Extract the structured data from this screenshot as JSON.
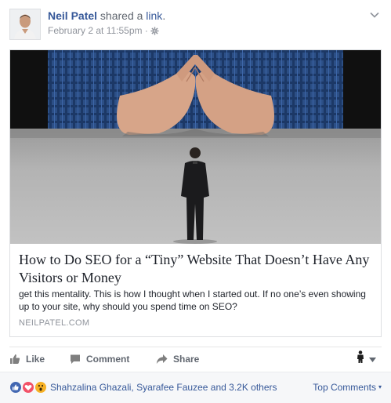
{
  "header": {
    "author": "Neil Patel",
    "action_text": " shared a ",
    "link_word": "link",
    "period": ".",
    "timestamp": "February 2 at 11:55pm",
    "separator": " · ",
    "audience_icon": "gear-icon",
    "menu_icon": "chevron-down-icon"
  },
  "card": {
    "title": "How to Do SEO for a “Tiny” Website That Doesn’t Have Any Visitors or Money",
    "description": "get this mentality. This is how I thought when I started out. If no one’s even showing up to your site, why should you spend time on SEO?",
    "domain": "NEILPATEL.COM"
  },
  "actions": {
    "like": "Like",
    "comment": "Comment",
    "share": "Share"
  },
  "footer": {
    "reactions": [
      "like",
      "love",
      "wow"
    ],
    "names": "Shahzalina Ghazali, Syarafee Fauzee and 3.2K others",
    "top_comments": "Top Comments",
    "caret": "▾"
  },
  "colors": {
    "link_blue": "#365899",
    "meta_gray": "#90949c",
    "action_gray": "#616770",
    "like_blue": "#4267b2",
    "love_red": "#f25268",
    "wow_yellow": "#f7b125"
  }
}
